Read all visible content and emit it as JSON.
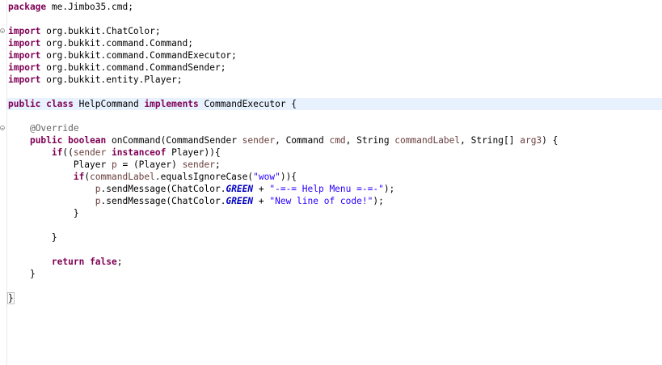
{
  "editor": {
    "lines": [
      [
        {
          "t": "package",
          "c": "kw"
        },
        {
          "t": " me.Jimbo35.cmd;"
        }
      ],
      [],
      [
        {
          "t": "import",
          "c": "kw"
        },
        {
          "t": " org.bukkit.ChatColor;"
        }
      ],
      [
        {
          "t": "import",
          "c": "kw"
        },
        {
          "t": " org.bukkit.command.Command;"
        }
      ],
      [
        {
          "t": "import",
          "c": "kw"
        },
        {
          "t": " org.bukkit.command.CommandExecutor;"
        }
      ],
      [
        {
          "t": "import",
          "c": "kw"
        },
        {
          "t": " org.bukkit.command.CommandSender;"
        }
      ],
      [
        {
          "t": "import",
          "c": "kw"
        },
        {
          "t": " org.bukkit.entity.Player;"
        }
      ],
      [],
      [
        {
          "t": "public",
          "c": "kw"
        },
        {
          "t": " "
        },
        {
          "t": "class",
          "c": "kw"
        },
        {
          "t": " HelpCommand "
        },
        {
          "t": "implements",
          "c": "kw"
        },
        {
          "t": " CommandExecutor {"
        }
      ],
      [],
      [
        {
          "t": "    "
        },
        {
          "t": "@Override",
          "c": "ann"
        }
      ],
      [
        {
          "t": "    "
        },
        {
          "t": "public",
          "c": "kw"
        },
        {
          "t": " "
        },
        {
          "t": "boolean",
          "c": "kw"
        },
        {
          "t": " onCommand(CommandSender "
        },
        {
          "t": "sender",
          "c": "param"
        },
        {
          "t": ", Command "
        },
        {
          "t": "cmd",
          "c": "param"
        },
        {
          "t": ", String "
        },
        {
          "t": "commandLabel",
          "c": "param"
        },
        {
          "t": ", String[] "
        },
        {
          "t": "arg3",
          "c": "param"
        },
        {
          "t": ") {"
        }
      ],
      [
        {
          "t": "        "
        },
        {
          "t": "if",
          "c": "kw"
        },
        {
          "t": "(("
        },
        {
          "t": "sender",
          "c": "param"
        },
        {
          "t": " "
        },
        {
          "t": "instanceof",
          "c": "kw"
        },
        {
          "t": " Player)){"
        }
      ],
      [
        {
          "t": "            Player "
        },
        {
          "t": "p",
          "c": "param"
        },
        {
          "t": " = (Player) "
        },
        {
          "t": "sender",
          "c": "param"
        },
        {
          "t": ";"
        }
      ],
      [
        {
          "t": "            "
        },
        {
          "t": "if",
          "c": "kw"
        },
        {
          "t": "("
        },
        {
          "t": "commandLabel",
          "c": "param"
        },
        {
          "t": ".equalsIgnoreCase("
        },
        {
          "t": "\"wow\"",
          "c": "str"
        },
        {
          "t": ")){"
        }
      ],
      [
        {
          "t": "                "
        },
        {
          "t": "p",
          "c": "param"
        },
        {
          "t": ".sendMessage(ChatColor."
        },
        {
          "t": "GREEN",
          "c": "const"
        },
        {
          "t": " + "
        },
        {
          "t": "\"-=-= Help Menu =-=-\"",
          "c": "str"
        },
        {
          "t": ");"
        }
      ],
      [
        {
          "t": "                "
        },
        {
          "t": "p",
          "c": "param"
        },
        {
          "t": ".sendMessage(ChatColor."
        },
        {
          "t": "GREEN",
          "c": "const"
        },
        {
          "t": " + "
        },
        {
          "t": "\"New line of code!\"",
          "c": "str"
        },
        {
          "t": ");"
        }
      ],
      [
        {
          "t": "            }"
        }
      ],
      [],
      [
        {
          "t": "        }"
        }
      ],
      [],
      [
        {
          "t": "        "
        },
        {
          "t": "return",
          "c": "kw"
        },
        {
          "t": " "
        },
        {
          "t": "false",
          "c": "kw"
        },
        {
          "t": ";"
        }
      ],
      [
        {
          "t": "    }"
        }
      ],
      [],
      [
        {
          "t": "}",
          "c": "brace"
        }
      ]
    ],
    "current_line_index": 8,
    "fold_marker_lines": [
      2,
      10
    ]
  }
}
